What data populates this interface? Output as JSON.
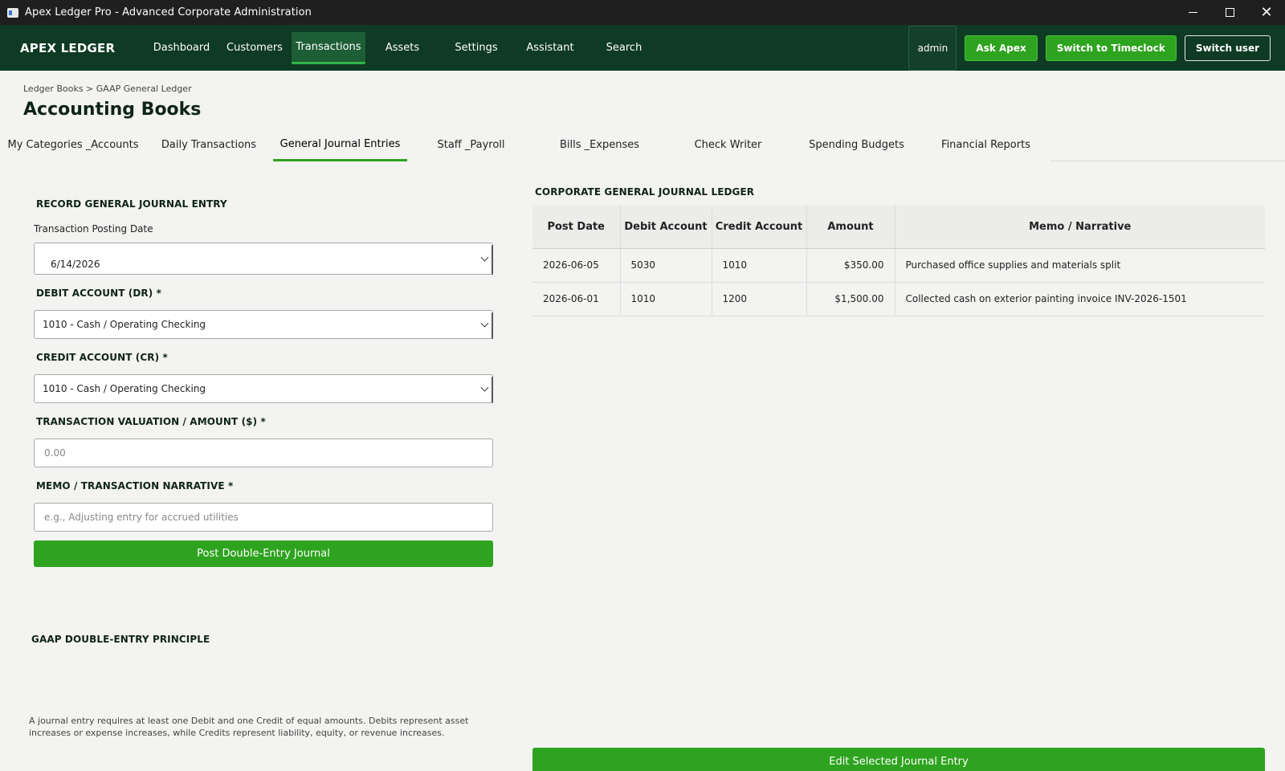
{
  "window": {
    "title": "Apex Ledger Pro - Advanced Corporate Administration"
  },
  "nav": {
    "brand": "APEX LEDGER",
    "items": [
      {
        "label": "Dashboard"
      },
      {
        "label": "Customers"
      },
      {
        "label": "Transactions",
        "active": true
      },
      {
        "label": "Assets"
      },
      {
        "label": "Settings"
      },
      {
        "label": "Assistant"
      },
      {
        "label": "Search"
      }
    ],
    "user": "admin",
    "ask_label": "Ask Apex",
    "timeclock_label": "Switch to Timeclock",
    "switch_user_label": "Switch user"
  },
  "breadcrumb": "Ledger Books > GAAP General Ledger",
  "page_title": "Accounting Books",
  "tabs": [
    {
      "label": "My Categories _Accounts"
    },
    {
      "label": "Daily Transactions"
    },
    {
      "label": "General Journal Entries",
      "active": true
    },
    {
      "label": "Staff _Payroll"
    },
    {
      "label": "Bills _Expenses"
    },
    {
      "label": "Check Writer"
    },
    {
      "label": "Spending Budgets"
    },
    {
      "label": "Financial Reports"
    }
  ],
  "form": {
    "section_title": "RECORD GENERAL JOURNAL ENTRY",
    "date_label": "Transaction Posting Date",
    "date_value": "6/14/2026",
    "debit_label": "DEBIT ACCOUNT (DR) *",
    "debit_value": "1010 - Cash / Operating Checking",
    "credit_label": "CREDIT ACCOUNT (CR) *",
    "credit_value": "1010 - Cash / Operating Checking",
    "amount_label": "TRANSACTION VALUATION / AMOUNT ($) *",
    "amount_placeholder": "0.00",
    "memo_label": "MEMO / TRANSACTION NARRATIVE *",
    "memo_placeholder": "e.g., Adjusting entry for accrued utilities",
    "post_label": "Post Double-Entry Journal"
  },
  "principle": {
    "title": "GAAP DOUBLE-ENTRY PRINCIPLE",
    "text": "A journal entry requires at least one Debit and one Credit of equal amounts. Debits represent asset increases or expense increases, while Credits represent liability, equity, or revenue increases."
  },
  "ledger": {
    "title": "CORPORATE GENERAL JOURNAL LEDGER",
    "columns": [
      "Post Date",
      "Debit Account",
      "Credit Account",
      "Amount",
      "Memo / Narrative"
    ],
    "rows": [
      [
        "2026-06-05",
        "5030",
        "1010",
        "$350.00",
        "Purchased office supplies and materials split"
      ],
      [
        "2026-06-01",
        "1010",
        "1200",
        "$1,500.00",
        "Collected cash on exterior painting invoice INV-2026-1501"
      ]
    ],
    "edit_label": "Edit Selected Journal Entry"
  }
}
